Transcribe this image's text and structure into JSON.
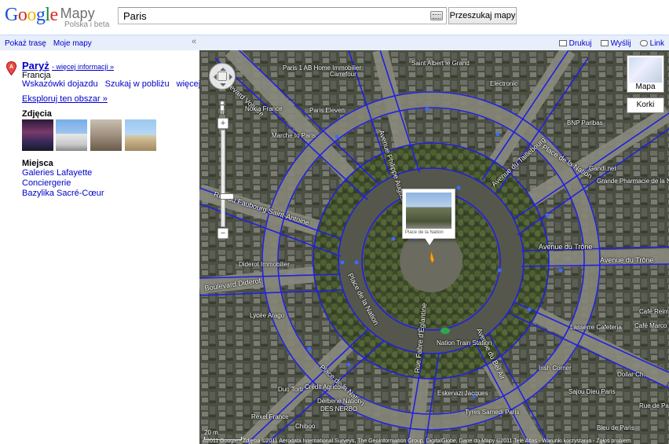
{
  "header": {
    "logo_google": "Google",
    "logo_product": "Mapy",
    "logo_subtitle": "Polska i beta",
    "search_value": "Paris",
    "search_button": "Przeszukaj mapy"
  },
  "topbar": {
    "route": "Pokaż trasę",
    "my_maps": "Moje mapy",
    "collapse": "«",
    "print": "Drukuj",
    "send": "Wyślij",
    "link": "Link"
  },
  "sidebar": {
    "title": "Paryż",
    "more_info": "- więcej informacji »",
    "country": "Francja",
    "directions": "Wskazówki dojazdu",
    "search_nearby": "Szukaj w pobliżu",
    "more": "więcej ▾",
    "explore": "Eksploruj ten obszar »",
    "photos_heading": "Zdjęcia",
    "places_heading": "Miejsca",
    "places": [
      "Galeries Lafayette",
      "Conciergerie",
      "Bazylika Sacré-Cœur"
    ]
  },
  "map": {
    "type_label": "Mapa",
    "traffic_label": "Korki",
    "scale_label": "20 m",
    "infowindow_caption": "Place de la Nation",
    "copyright": "©2011 Google - Zdjęcia ©2011 Aerodata International Surveys, The GeoInformation Group, DigitalGlobe, Dane do Mapy ©2011 Tele Atlas - Warunki korzystania - Zgłoś problem",
    "roads": [
      "Boulevard Voltaire",
      "Avenue Philippe Auguste",
      "Avenue du Taillebourg",
      "Rue du Faubourg Saint-Antoine",
      "Avenue du Trône",
      "Avenue du Trône",
      "Boulevard Diderot",
      "Place de la Nation",
      "Rue Fabre d'Églantine",
      "Avenue du Bel Air",
      "Place de la Nation",
      "Place de la Nation"
    ],
    "pois": [
      "Saint Albert le Grand",
      "Paris 1 AB Home Immobilier",
      "Carrefour",
      "Nokia France",
      "Marche to Paris",
      "Paris Eleven",
      "Electronic",
      "BNP Paribas",
      "Gandi.net",
      "Grande Pharmacie de la Nation",
      "Diderot Immobilier",
      "Lycée Arago",
      "Nation Train Station",
      "Café Marco Polo",
      "Lasserre Cafeteria",
      "Irish Corner",
      "Dollar Ch.",
      "Eskenazi Jacques",
      "Tyres Samedi Paris",
      "Crédit Agricole",
      "Duo Torti",
      "Derbene Nation",
      "DES NERBO",
      "Rexel France",
      "Chiboo",
      "Bleu de Paris",
      "Rue de Paris",
      "Sajou Dieu Paris",
      "Café Reims"
    ],
    "accent_color": "#2020e0"
  }
}
